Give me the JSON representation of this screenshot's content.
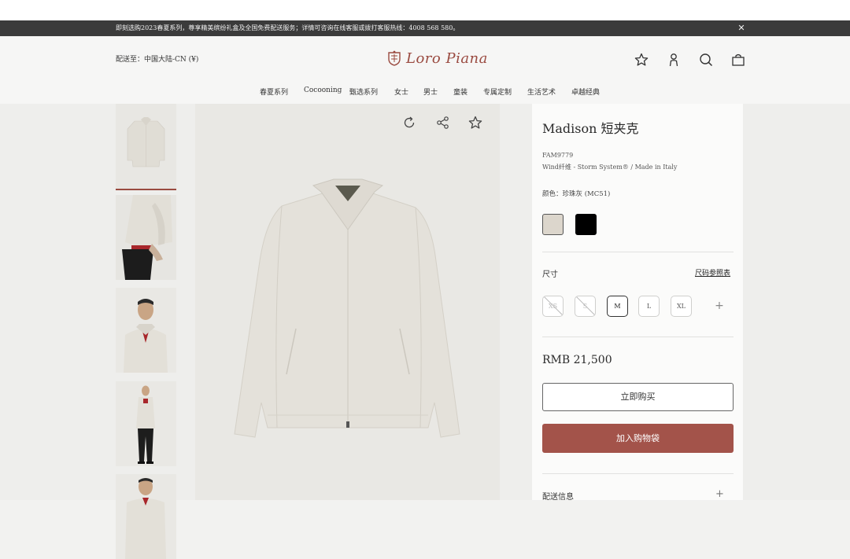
{
  "announcement": {
    "text": "即刻选购2023春夏系列，尊享精美缤纷礼盒及全国免费配送服务；详情可咨询在线客服或拨打客服热线：4008 568 580。",
    "close_icon": "close-icon"
  },
  "header": {
    "ship_to": "配送至：中国大陆-CN (¥)",
    "logo_text": "Loro Piana",
    "icons": [
      "star-icon",
      "user-icon",
      "search-icon",
      "bag-icon"
    ]
  },
  "nav": {
    "items": [
      "春夏系列",
      "Cocooning",
      "甄选系列",
      "女士",
      "男士",
      "童装",
      "专属定制",
      "生活艺术",
      "卓越经典"
    ]
  },
  "gallery": {
    "thumbnails": [
      "jacket-front",
      "jacket-sleeve-detail",
      "model-portrait",
      "model-full-body",
      "model-partial"
    ],
    "main_icons": [
      "rotate-360-icon",
      "share-icon",
      "favorite-star-icon"
    ]
  },
  "product": {
    "title": "Madison 短夹克",
    "code": "FAM9779",
    "material": "Wind纤维 - Storm System® / Made in Italy",
    "color_label": "颜色：珍珠灰 (MC51)",
    "colors": [
      "#dcd6cc",
      "#000000"
    ],
    "size_label": "尺寸",
    "size_guide": "尺码参照表",
    "sizes": [
      {
        "label": "XS",
        "state": "unavailable"
      },
      {
        "label": "S",
        "state": "unavailable"
      },
      {
        "label": "M",
        "state": "selected"
      },
      {
        "label": "L",
        "state": "available"
      },
      {
        "label": "XL",
        "state": "available"
      }
    ],
    "price": "RMB 21,500",
    "buy_now": "立即购买",
    "add_to_bag": "加入购物袋",
    "shipping_info": "配送信息"
  },
  "colors": {
    "accent": "#a3534a",
    "announcement_bg": "#3b3b3b"
  }
}
